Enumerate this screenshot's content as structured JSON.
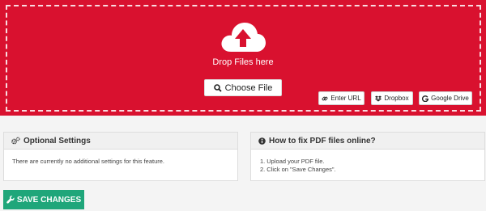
{
  "upload": {
    "drop_text": "Drop Files here",
    "choose_label": "Choose File",
    "url_label": "Enter URL",
    "dropbox_label": "Dropbox",
    "gdrive_label": "Google Drive"
  },
  "settings_panel": {
    "title": "Optional Settings",
    "body": "There are currently no additional settings for this feature."
  },
  "howto_panel": {
    "title": "How to fix PDF files online?",
    "steps": [
      {
        "num": "1.",
        "text": "Upload your PDF file."
      },
      {
        "num": "2.",
        "text": "Click on \"Save Changes\"."
      }
    ]
  },
  "save_label": "SAVE CHANGES",
  "colors": {
    "accent_red": "#d9112f",
    "save_green": "#1fa67a"
  },
  "icons": [
    "cloud-upload-icon",
    "search-icon",
    "link-icon",
    "dropbox-icon",
    "google-icon",
    "gears-icon",
    "info-icon",
    "wrench-icon"
  ]
}
